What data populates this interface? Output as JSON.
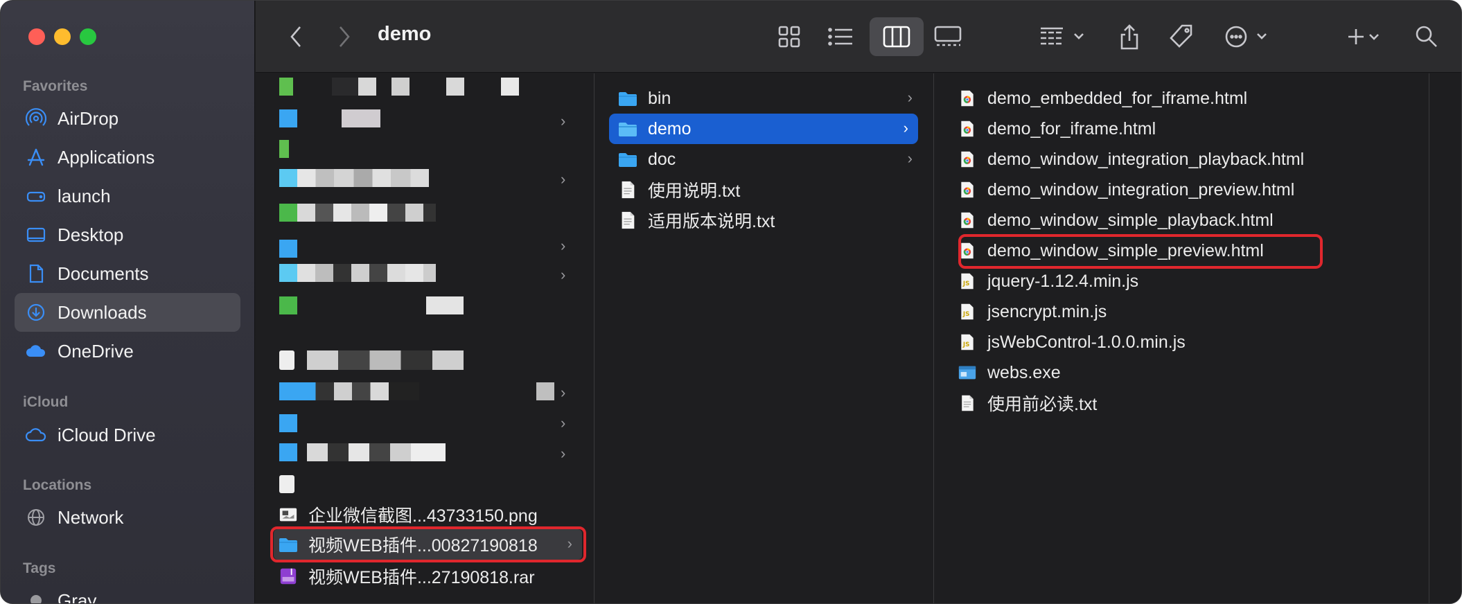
{
  "window": {
    "title": "demo"
  },
  "sidebar": {
    "sections": [
      {
        "label": "Favorites"
      },
      {
        "label": "iCloud"
      },
      {
        "label": "Locations"
      },
      {
        "label": "Tags"
      }
    ],
    "favorites": [
      {
        "label": "AirDrop",
        "icon": "airdrop-icon"
      },
      {
        "label": "Applications",
        "icon": "applications-icon"
      },
      {
        "label": "launch",
        "icon": "drive-icon"
      },
      {
        "label": "Desktop",
        "icon": "desktop-icon"
      },
      {
        "label": "Documents",
        "icon": "document-icon"
      },
      {
        "label": "Downloads",
        "icon": "downloads-icon"
      },
      {
        "label": "OneDrive",
        "icon": "cloud-icon"
      }
    ],
    "icloud": [
      {
        "label": "iCloud Drive",
        "icon": "icloud-icon"
      }
    ],
    "locations": [
      {
        "label": "Network",
        "icon": "network-icon"
      }
    ],
    "tags": [
      {
        "label": "Gray",
        "color": "#9a9a9e"
      }
    ]
  },
  "toolbar": {
    "back": "chevron-left-icon",
    "forward": "chevron-right-icon",
    "views": [
      "icon-view-icon",
      "list-view-icon",
      "column-view-icon",
      "gallery-view-icon"
    ],
    "selected_view": "column-view-icon",
    "group": "group-by-icon",
    "share": "share-icon",
    "tag": "tag-icon",
    "more": "more-icon",
    "add": "plus-icon",
    "search": "search-icon"
  },
  "column1": {
    "visible_items": [
      {
        "name": "企业微信截图...43733150.png",
        "kind": "image"
      },
      {
        "name": "视频WEB插件...00827190818",
        "kind": "folder"
      },
      {
        "name": "视频WEB插件...27190818.rar",
        "kind": "archive"
      }
    ]
  },
  "column2": {
    "items": [
      {
        "name": "bin",
        "kind": "folder"
      },
      {
        "name": "demo",
        "kind": "folder"
      },
      {
        "name": "doc",
        "kind": "folder"
      },
      {
        "name": "使用说明.txt",
        "kind": "text"
      },
      {
        "name": "适用版本说明.txt",
        "kind": "text"
      }
    ]
  },
  "column3": {
    "items": [
      {
        "name": "demo_embedded_for_iframe.html",
        "kind": "html"
      },
      {
        "name": "demo_for_iframe.html",
        "kind": "html"
      },
      {
        "name": "demo_window_integration_playback.html",
        "kind": "html"
      },
      {
        "name": "demo_window_integration_preview.html",
        "kind": "html"
      },
      {
        "name": "demo_window_simple_playback.html",
        "kind": "html"
      },
      {
        "name": "demo_window_simple_preview.html",
        "kind": "html"
      },
      {
        "name": "jquery-1.12.4.min.js",
        "kind": "js"
      },
      {
        "name": "jsencrypt.min.js",
        "kind": "js"
      },
      {
        "name": "jsWebControl-1.0.0.min.js",
        "kind": "js"
      },
      {
        "name": "webs.exe",
        "kind": "exe"
      },
      {
        "name": "使用前必读.txt",
        "kind": "text"
      }
    ]
  },
  "colors": {
    "selection": "#1a5fd1",
    "highlight_box": "#e0272d",
    "folder": "#3aa6f2"
  }
}
